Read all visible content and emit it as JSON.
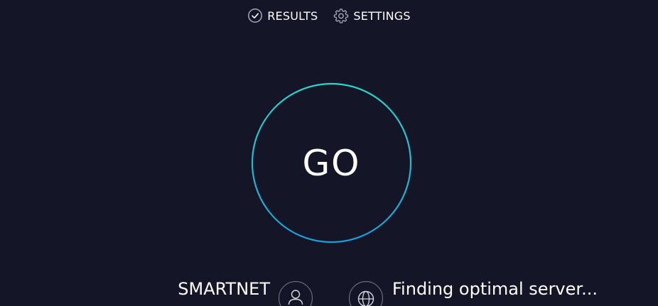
{
  "nav": {
    "results_label": "RESULTS",
    "settings_label": "SETTINGS"
  },
  "go_button": {
    "label": "GO"
  },
  "connection": {
    "isp_name": "SMARTNET",
    "server_status": "Finding optimal server..."
  },
  "colors": {
    "background": "#141526",
    "ring_start": "#2dd4c8",
    "ring_end": "#1c9fd8",
    "icon_stroke": "#9a9cb0"
  },
  "icons": {
    "results": "check-circle-icon",
    "settings": "gear-icon",
    "isp": "person-icon",
    "server": "globe-icon"
  }
}
